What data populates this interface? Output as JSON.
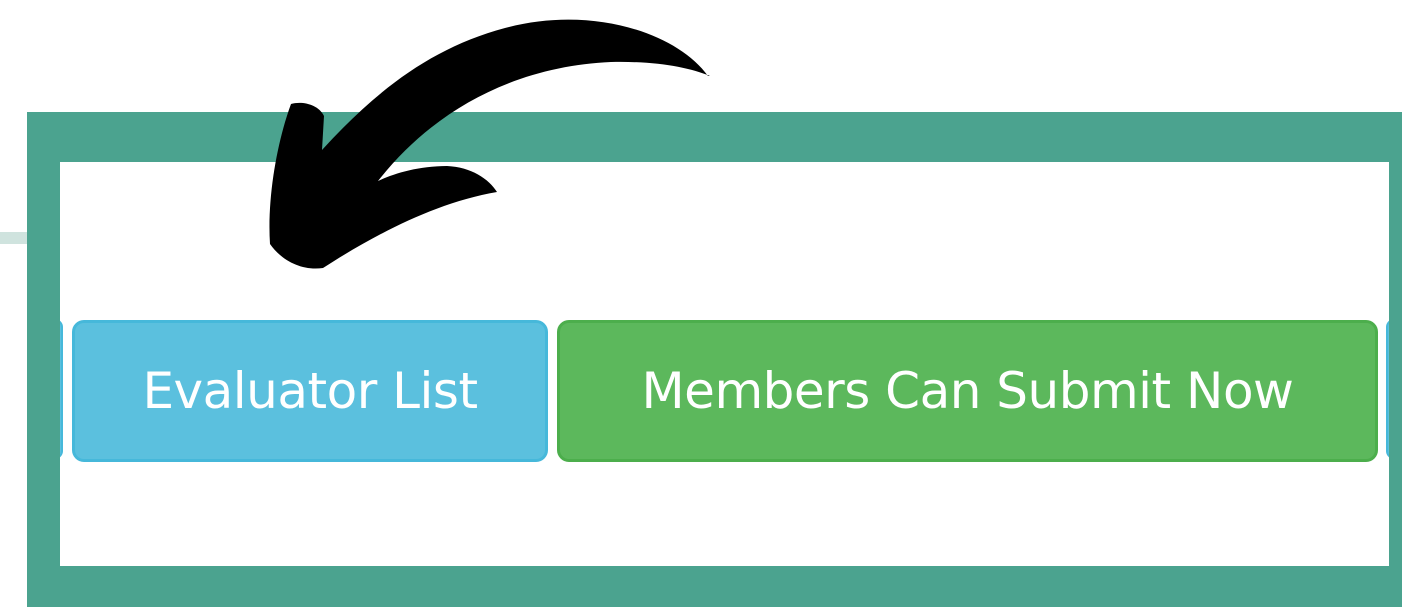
{
  "buttons": {
    "evaluator_list": "Evaluator List",
    "members_can_submit_now": "Members Can Submit Now"
  },
  "colors": {
    "frame": "#4ba38f",
    "info_button": "#5bc0de",
    "success_button": "#5cb85c",
    "arrow": "#000000"
  },
  "icons": {
    "pointer": "curved-arrow-icon"
  }
}
